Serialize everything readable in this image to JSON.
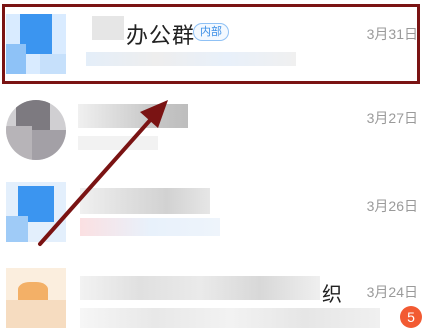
{
  "chats": [
    {
      "title": "办公群",
      "tag": "内部",
      "date": "3月31日"
    },
    {
      "title": "",
      "date": "3月27日"
    },
    {
      "title": "",
      "date": "3月26日"
    },
    {
      "title": "织",
      "date": "3月24日",
      "unread": "5"
    }
  ],
  "colors": {
    "highlight": "#7a1313",
    "accent": "#3a8ee6",
    "badge": "#f25a32"
  }
}
